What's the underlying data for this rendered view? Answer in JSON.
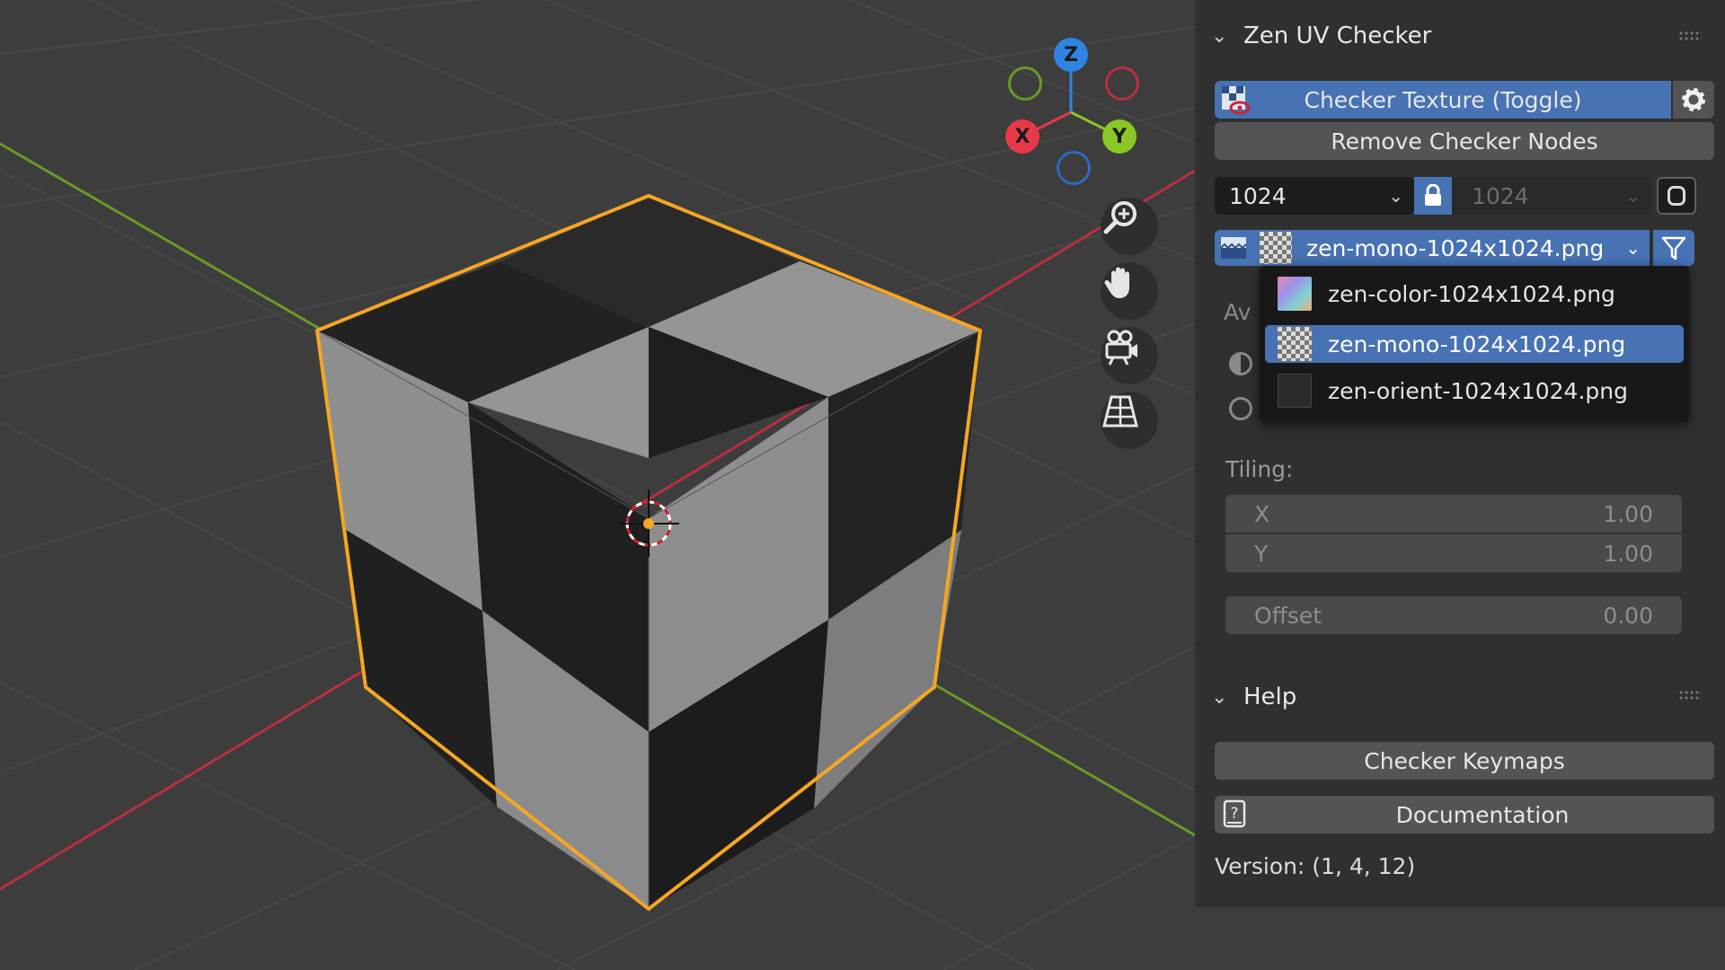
{
  "viewport": {
    "gizmo": {
      "z": "Z",
      "x": "X",
      "y": "Y"
    },
    "nav_icons": [
      "zoom-icon",
      "pan-hand-icon",
      "camera-icon",
      "perspective-grid-icon"
    ]
  },
  "checker_panel": {
    "title": "Zen UV Checker",
    "toggle_label": "Checker Texture (Toggle)",
    "remove_label": "Remove Checker Nodes",
    "resolution_x": "1024",
    "resolution_y": "1024",
    "selected_texture": "zen-mono-1024x1024.png",
    "dropdown_options": [
      {
        "label": "zen-color-1024x1024.png",
        "selected": false
      },
      {
        "label": "zen-mono-1024x1024.png",
        "selected": true
      },
      {
        "label": "zen-orient-1024x1024.png",
        "selected": false
      }
    ],
    "partial_label": "Av",
    "tiling_label": "Tiling:",
    "tiling_x_label": "X",
    "tiling_x_value": "1.00",
    "tiling_y_label": "Y",
    "tiling_y_value": "1.00",
    "offset_label": "Offset",
    "offset_value": "0.00"
  },
  "help_panel": {
    "title": "Help",
    "keymaps_label": "Checker Keymaps",
    "documentation_label": "Documentation",
    "version_text": "Version: (1, 4, 12)"
  },
  "colors": {
    "accent": "#4772b3",
    "selection_outline": "#f5a623",
    "axis_x": "#e8394b",
    "axis_y": "#8bc825",
    "axis_z": "#2f84e3"
  }
}
